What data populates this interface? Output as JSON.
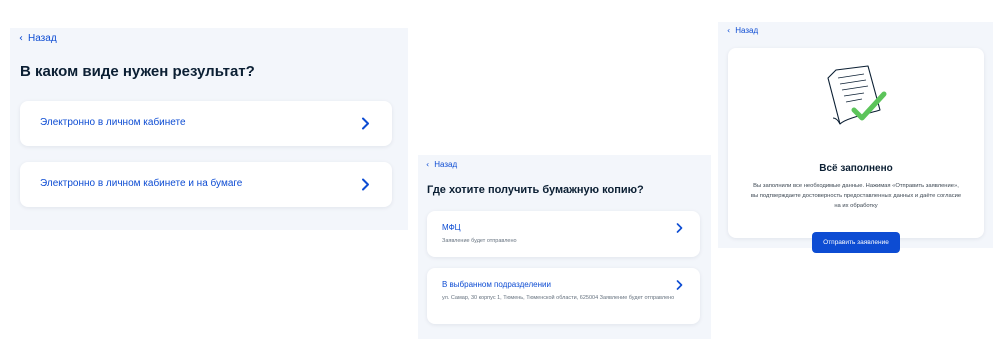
{
  "panel1": {
    "back_label": "Назад",
    "title": "В каком виде нужен результат?",
    "options": [
      {
        "label": "Электронно в личном кабинете"
      },
      {
        "label": "Электронно в личном кабинете и на бумаге"
      }
    ]
  },
  "panel2": {
    "back_label": "Назад",
    "title": "Где хотите получить бумажную копию?",
    "options": [
      {
        "label": "МФЦ",
        "description": "Заявление будет отправлено"
      },
      {
        "label": "В выбранном подразделении",
        "description": "ул. Самар, 30 корпус 1, Тюмень, Тюменской области, 625004 Заявление будет отправлено"
      }
    ]
  },
  "panel3": {
    "back_label": "Назад",
    "title": "Всё заполнено",
    "text": "Вы заполнили все необходимые данные. Нажимая «Отправить заявление», вы подтверждаете достоверность предоставленных данных и даёте согласие на их обработку",
    "submit_label": "Отправить заявление"
  },
  "colors": {
    "accent": "#0d4cd3",
    "panel_bg": "#f3f6fb",
    "success": "#5cc45a"
  }
}
